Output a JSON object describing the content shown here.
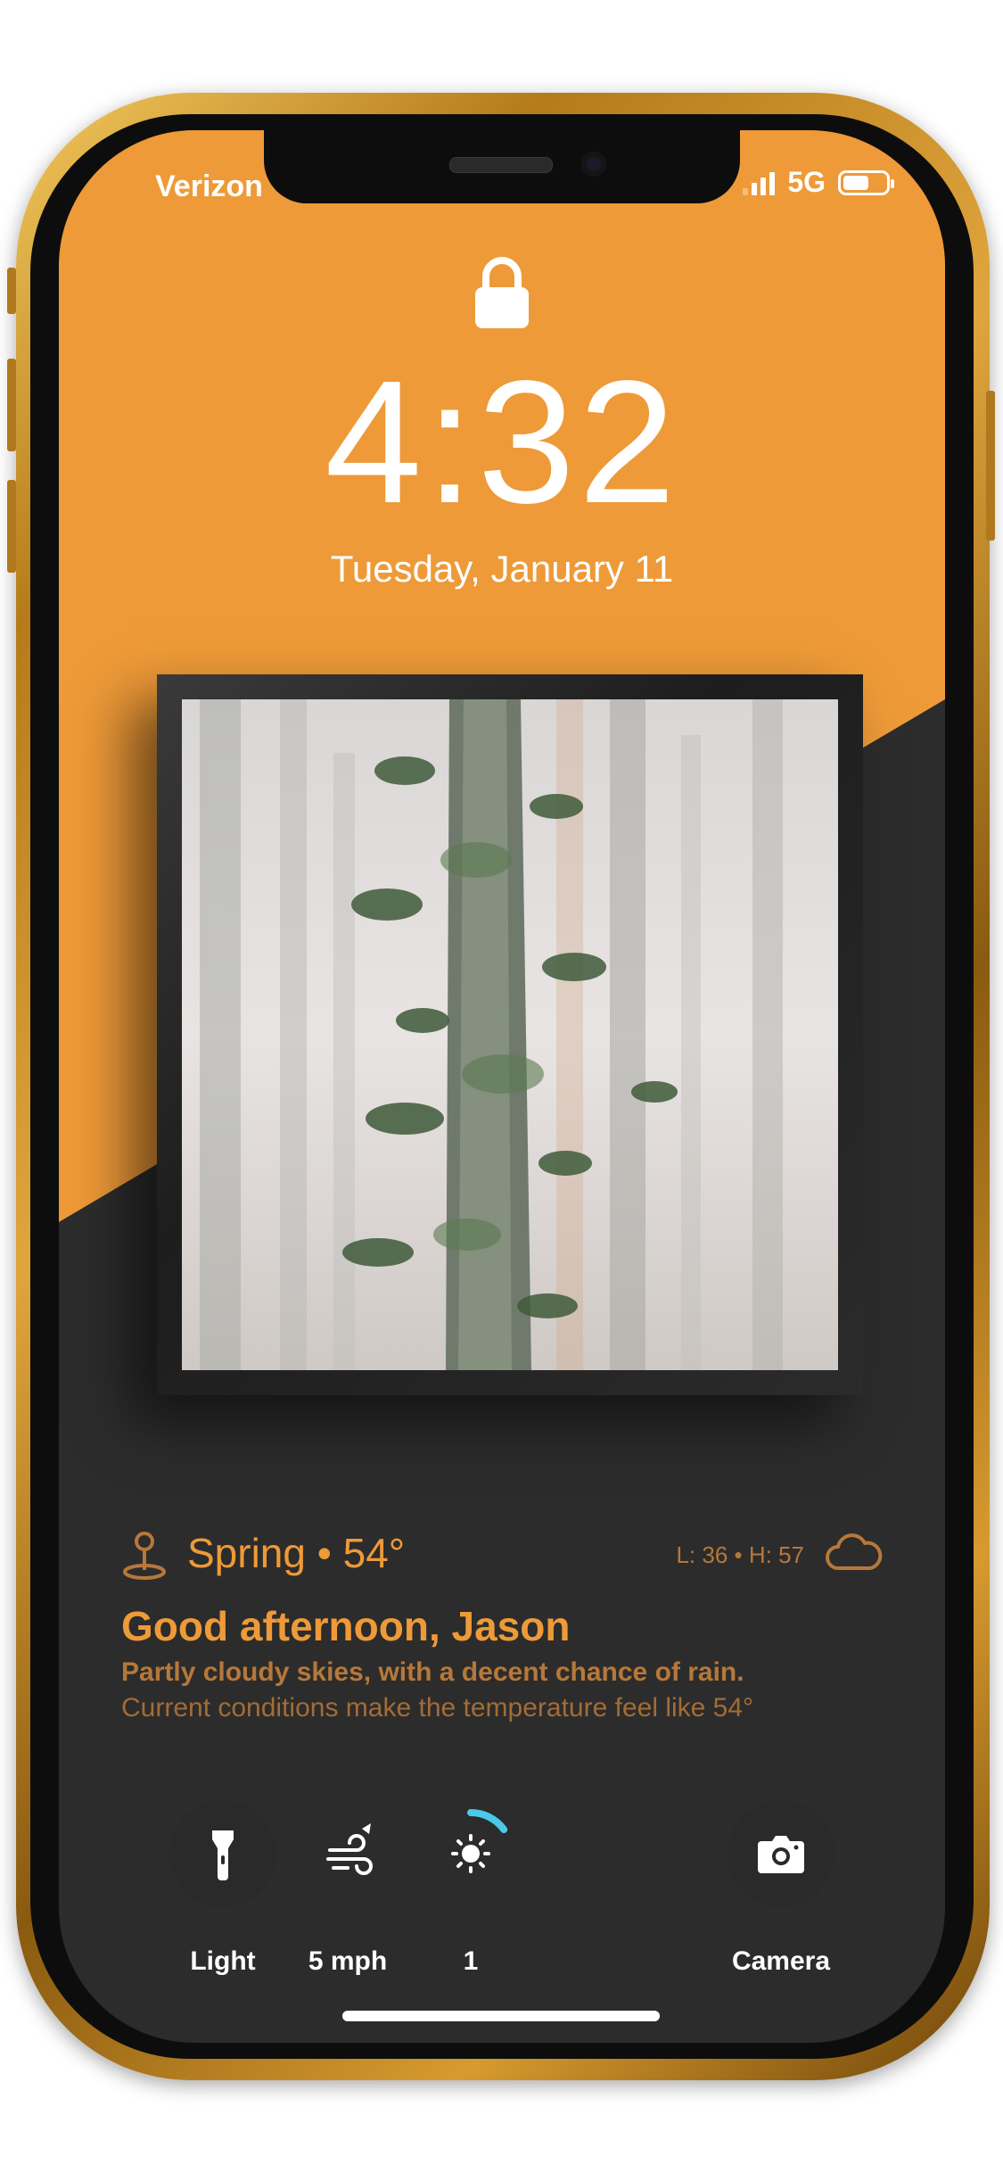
{
  "status_bar": {
    "carrier": "Verizon",
    "network": "5G",
    "battery_level": 0.6
  },
  "lock_screen": {
    "time": "4:32",
    "date": "Tuesday, January 11"
  },
  "weather": {
    "location": "Spring • 54°",
    "low_high": "L: 36 • H: 57",
    "greeting": "Good afternoon, Jason",
    "summary": "Partly cloudy skies, with a decent chance of rain.",
    "detail": "Current conditions make the temperature feel like 54°"
  },
  "controls": [
    {
      "label": "Light",
      "icon": "flashlight-icon"
    },
    {
      "label": "5 mph",
      "icon": "wind-icon"
    },
    {
      "label": "1",
      "icon": "sun-icon",
      "progress": 0.15
    },
    {
      "label": "Camera",
      "icon": "camera-icon"
    }
  ],
  "colors": {
    "accent": "#ee9a38",
    "background_dark": "#2c2c2c",
    "wallpaper_orange": "#ee9a38",
    "uv_ring": "#4cc9e8"
  }
}
